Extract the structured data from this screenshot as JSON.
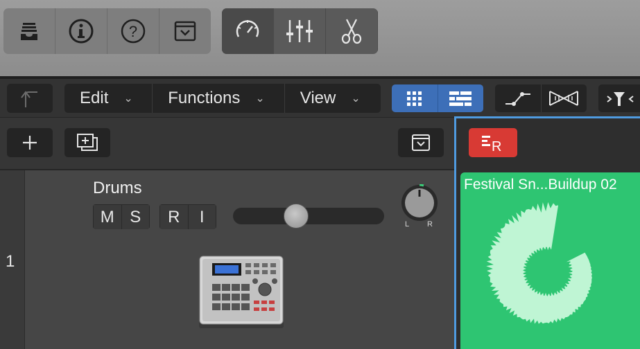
{
  "toolbar": {
    "left_buttons": [
      "library-icon",
      "info-icon",
      "help-icon",
      "dropdown-box-icon"
    ],
    "right_buttons": [
      "tuner-icon",
      "mixer-icon",
      "scissors-icon"
    ]
  },
  "control_bar": {
    "menus": [
      {
        "label": "Edit"
      },
      {
        "label": "Functions"
      },
      {
        "label": "View"
      }
    ]
  },
  "track": {
    "number": "1",
    "name": "Drums",
    "buttons": [
      "M",
      "S",
      "R",
      "I"
    ],
    "pan_left": "L",
    "pan_right": "R",
    "volume_level": 0.4
  },
  "region": {
    "title": "Festival Sn...Buildup 02",
    "color": "#2ec572"
  }
}
